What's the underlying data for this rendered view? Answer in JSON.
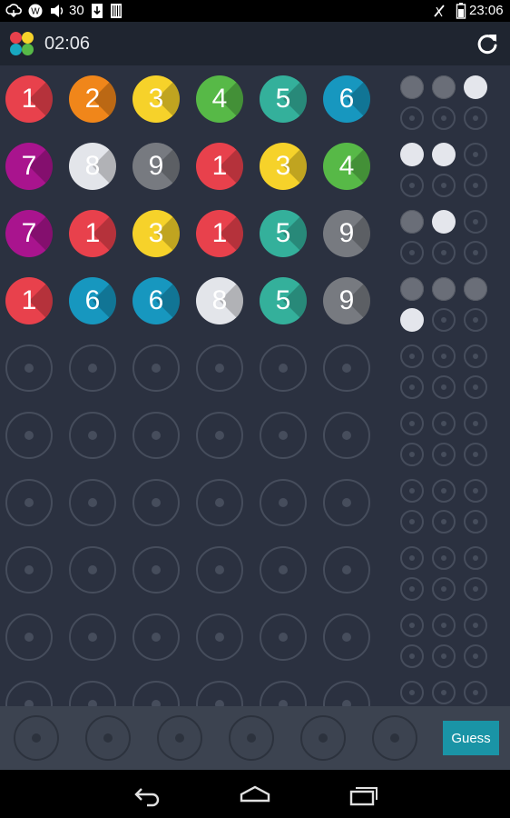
{
  "status_bar": {
    "volume": "30",
    "time": "23:06"
  },
  "toolbar": {
    "timer": "02:06",
    "restart_icon": "refresh-icon",
    "logo_colors": [
      "#e8414c",
      "#f6d22a",
      "#18a8c0",
      "#57b947"
    ]
  },
  "colors": {
    "1": "#e8414c",
    "2": "#f0861a",
    "3": "#f6d22a",
    "4": "#57b947",
    "5": "#34b09b",
    "6": "#1797bf",
    "7": "#a9148e",
    "8": "#e3e5ea",
    "9": "#777a80"
  },
  "board": {
    "guesses": [
      {
        "pegs": [
          "1",
          "2",
          "3",
          "4",
          "5",
          "6"
        ],
        "feedback": [
          "exact",
          "exact",
          "partial"
        ]
      },
      {
        "pegs": [
          "7",
          "8",
          "9",
          "1",
          "3",
          "4"
        ],
        "feedback": [
          "partial",
          "partial"
        ]
      },
      {
        "pegs": [
          "7",
          "1",
          "3",
          "1",
          "5",
          "9"
        ],
        "feedback": [
          "exact",
          "partial"
        ]
      },
      {
        "pegs": [
          "1",
          "6",
          "6",
          "8",
          "5",
          "9"
        ],
        "feedback": [
          "exact",
          "exact",
          "exact",
          "partial"
        ]
      },
      {
        "pegs": [],
        "feedback": []
      },
      {
        "pegs": [],
        "feedback": []
      },
      {
        "pegs": [],
        "feedback": []
      },
      {
        "pegs": [],
        "feedback": []
      },
      {
        "pegs": [],
        "feedback": []
      },
      {
        "pegs": [],
        "feedback": []
      }
    ]
  },
  "input": {
    "slots": [
      "",
      "",
      "",
      "",
      "",
      ""
    ],
    "guess_label": "Guess"
  },
  "nav": {
    "icons": [
      "back-icon",
      "home-icon",
      "recent-apps-icon"
    ]
  }
}
